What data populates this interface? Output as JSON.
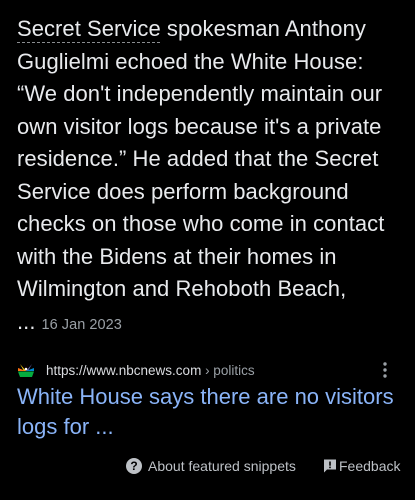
{
  "snippet": {
    "lead": "Secret Service",
    "text": " spokesman Anthony Guglielmi echoed the White House: “We don't independently maintain our own visitor logs because it's a private residence.” He added that the Secret Service does perform background checks on those who come in contact with the Bidens at their homes in Wilmington and Rehoboth Beach, ...",
    "date": "16 Jan 2023"
  },
  "source": {
    "favicon_icon": "nbc-peacock-icon",
    "url": "https://www.nbcnews.com",
    "breadcrumb": " › politics",
    "more_icon": "more-vert-icon"
  },
  "result": {
    "title": "White House says there are no visitors logs for ..."
  },
  "footer": {
    "about_label": "About featured snippets",
    "about_icon": "help-circle-icon",
    "feedback_label": "Feedback",
    "feedback_icon": "feedback-icon"
  },
  "colors": {
    "background": "#000000",
    "text": "#e8eaed",
    "link": "#8ab4f8",
    "muted": "#9aa0a6"
  }
}
